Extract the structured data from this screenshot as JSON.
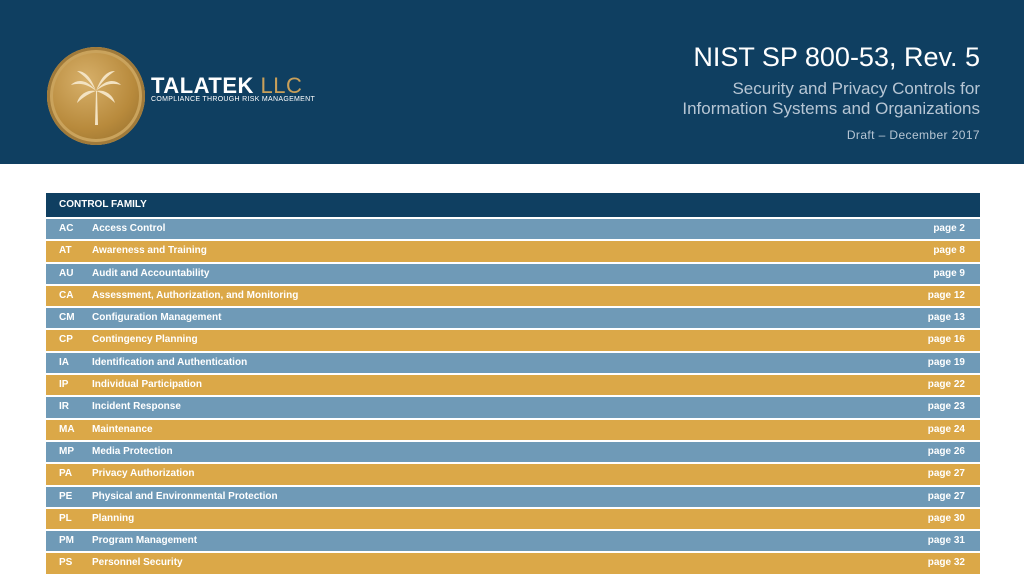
{
  "brand": {
    "name": "TALATEK",
    "suffix": "LLC",
    "tagline": "COMPLIANCE THROUGH RISK MANAGEMENT"
  },
  "document": {
    "title": "NIST SP 800-53, Rev. 5",
    "subtitle_line1": "Security and Privacy Controls for",
    "subtitle_line2": "Information Systems and Organizations",
    "date": "Draft – December 2017"
  },
  "colors": {
    "header": "#0f3f61",
    "row_blue": "#6f9ab7",
    "row_gold": "#dba848",
    "logo_gold": "#c9a05a"
  },
  "table": {
    "header": "CONTROL FAMILY",
    "rows": [
      {
        "code": "AC",
        "name": "Access Control",
        "page": "page 2",
        "color": "blue"
      },
      {
        "code": "AT",
        "name": "Awareness and Training",
        "page": "page 8",
        "color": "gold"
      },
      {
        "code": "AU",
        "name": "Audit and Accountability",
        "page": "page 9",
        "color": "blue"
      },
      {
        "code": "CA",
        "name": "Assessment, Authorization, and Monitoring",
        "page": "page 12",
        "color": "gold"
      },
      {
        "code": "CM",
        "name": "Configuration Management",
        "page": "page 13",
        "color": "blue"
      },
      {
        "code": "CP",
        "name": "Contingency Planning",
        "page": "page 16",
        "color": "gold"
      },
      {
        "code": "IA",
        "name": "Identification and Authentication",
        "page": "page 19",
        "color": "blue"
      },
      {
        "code": "IP",
        "name": "Individual Participation",
        "page": "page 22",
        "color": "gold"
      },
      {
        "code": "IR",
        "name": "Incident Response",
        "page": "page 23",
        "color": "blue"
      },
      {
        "code": "MA",
        "name": "Maintenance",
        "page": "page 24",
        "color": "gold"
      },
      {
        "code": "MP",
        "name": "Media Protection",
        "page": "page 26",
        "color": "blue"
      },
      {
        "code": "PA",
        "name": "Privacy Authorization",
        "page": "page 27",
        "color": "gold"
      },
      {
        "code": "PE",
        "name": "Physical and Environmental Protection",
        "page": "page 27",
        "color": "blue"
      },
      {
        "code": "PL",
        "name": "Planning",
        "page": "page 30",
        "color": "gold"
      },
      {
        "code": "PM",
        "name": "Program Management",
        "page": "page 31",
        "color": "blue"
      },
      {
        "code": "PS",
        "name": "Personnel Security",
        "page": "page 32",
        "color": "gold"
      }
    ]
  }
}
